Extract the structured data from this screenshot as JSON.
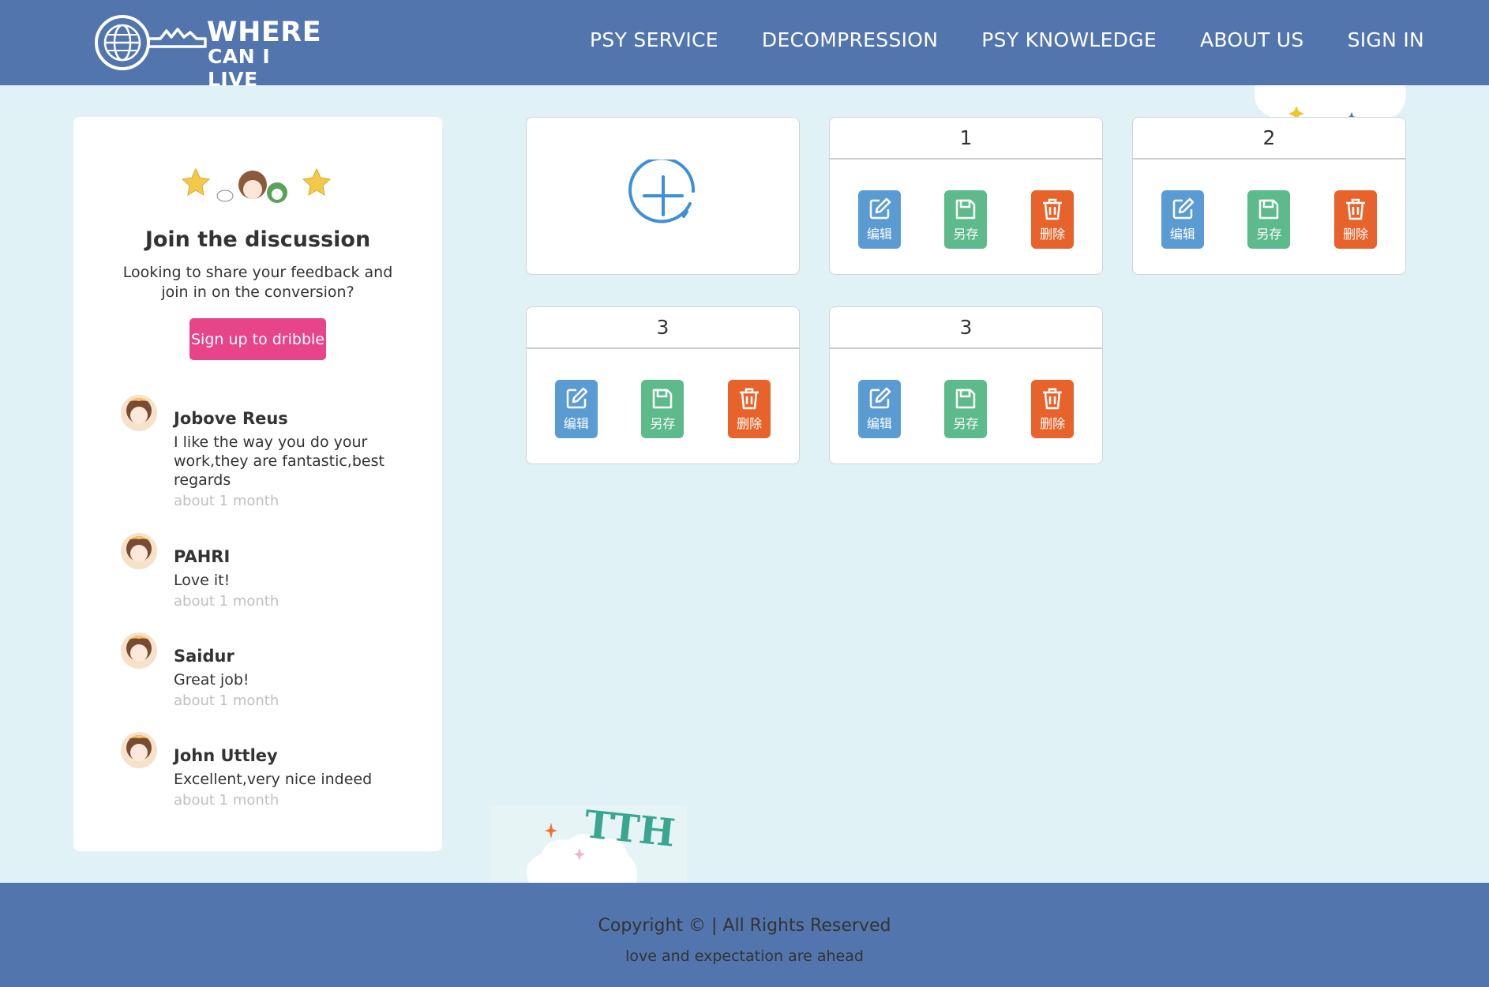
{
  "brand": {
    "line1": "WHERE",
    "line2": "CAN I LIVE"
  },
  "nav": {
    "items": [
      "PSY SERVICE",
      "DECOMPRESSION",
      "PSY KNOWLEDGE",
      "ABOUT US",
      "SIGN IN"
    ]
  },
  "panel": {
    "title": "Join the discussion",
    "description": "Looking to share your feedback and join in on the conversion?",
    "signup_label": "Sign up to dribble"
  },
  "comments": [
    {
      "name": "Jobove Reus",
      "text": "I like the way you do your work,they are fantastic,best regards",
      "time": "about 1 month"
    },
    {
      "name": "PAHRI",
      "text": "Love it!",
      "time": "about 1 month"
    },
    {
      "name": "Saidur",
      "text": "Great job!",
      "time": "about 1 month"
    },
    {
      "name": "John Uttley",
      "text": "Excellent,very nice indeed",
      "time": "about 1 month"
    }
  ],
  "cards": [
    {
      "title": "1"
    },
    {
      "title": "2"
    },
    {
      "title": "3"
    },
    {
      "title": "3"
    }
  ],
  "actions": {
    "edit": "编辑",
    "save": "另存",
    "delete": "删除"
  },
  "deco_text": "TTH",
  "footer": {
    "copyright": "Copyright © | All Rights Reserved",
    "tagline": "love and expectation are ahead"
  },
  "colors": {
    "header": "#5275ad",
    "background": "#e1f2f7",
    "signup": "#e8448a",
    "edit": "#5b9bd3",
    "save": "#5dba8a",
    "delete": "#e8632b"
  }
}
